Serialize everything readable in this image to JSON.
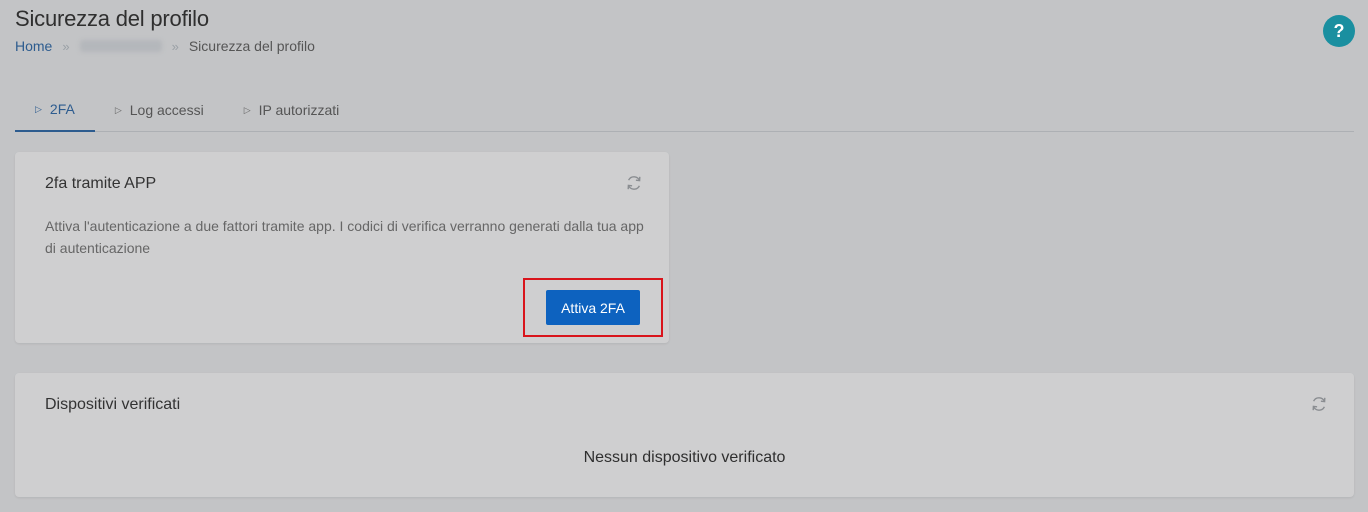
{
  "header": {
    "title": "Sicurezza del profilo",
    "breadcrumb": {
      "home": "Home",
      "separator": "»",
      "current": "Sicurezza del profilo"
    },
    "help_label": "?"
  },
  "tabs": [
    {
      "label": "2FA",
      "active": true
    },
    {
      "label": "Log accessi",
      "active": false
    },
    {
      "label": "IP autorizzati",
      "active": false
    }
  ],
  "cards": {
    "app_2fa": {
      "title": "2fa tramite APP",
      "description": "Attiva l'autenticazione a due fattori tramite app. I codici di verifica verranno generati dalla tua app di autenticazione",
      "button_label": "Attiva 2FA"
    },
    "devices": {
      "title": "Dispositivi verificati",
      "empty_message": "Nessun dispositivo verificato"
    }
  },
  "colors": {
    "accent": "#2d5c8f",
    "primary_button": "#0d62bf",
    "help_button": "#1a8fa0",
    "highlight": "#d9141b"
  },
  "icons": {
    "help": "question-icon",
    "tab_marker": "triangle-right-icon",
    "refresh": "refresh-icon"
  }
}
